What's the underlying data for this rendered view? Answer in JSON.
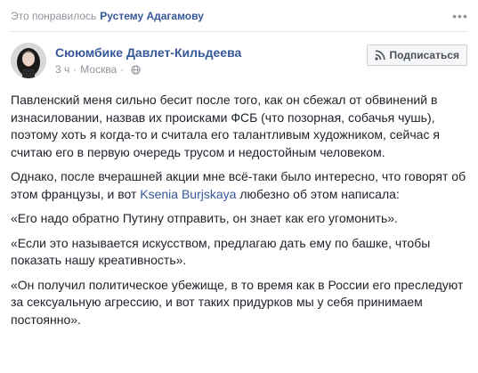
{
  "activity": {
    "prefix": "Это понравилось",
    "name": "Рустему Адагамову"
  },
  "post": {
    "author": "Сююмбике Давлет-Кильдеева",
    "time": "3 ч",
    "location": "Москва",
    "subscribe_label": "Подписаться",
    "paragraphs": [
      "Павленский меня сильно бесит после того, как он сбежал от обвинений в изнасиловании, назвав их происками ФСБ (что позорная, собачья чушь), поэтому хоть я когда-то и считала его талантливым художником, сейчас я считаю его в первую очередь трусом и недостойным человеком.",
      "«Его надо обратно Путину отправить, он знает как его угомонить».",
      "«Если это называется искусством, предлагаю дать ему по башке, чтобы показать нашу креативность».",
      "«Он получил политическое убежище, в то время как в России его преследуют за сексуальную агрессию, и вот таких придурков мы у себя принимаем постоянно»."
    ],
    "p2": {
      "before": "Однако, после вчерашней акции мне всё-таки было интересно, что говорят об этом французы, и вот",
      "mention": "Ksenia Burjskaya",
      "after": "любезно об этом написала:"
    }
  },
  "icons": {
    "more": "more-dots-icon",
    "globe": "globe-icon",
    "rss": "rss-icon"
  },
  "colors": {
    "link": "#365899",
    "muted": "#90949c",
    "text": "#1d2129"
  }
}
